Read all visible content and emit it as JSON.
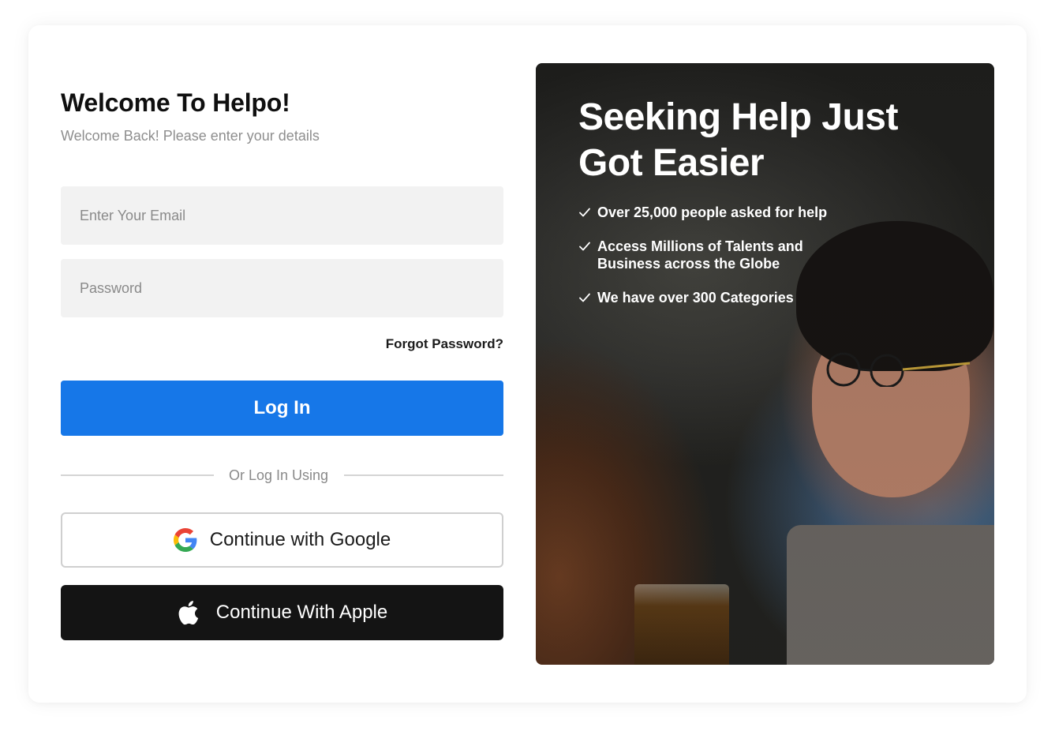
{
  "login": {
    "title": "Welcome To Helpo!",
    "subtitle": "Welcome Back! Please enter your details",
    "email_placeholder": "Enter Your Email",
    "password_placeholder": "Password",
    "forgot_label": "Forgot Password?",
    "login_label": "Log In",
    "divider_label": "Or Log In Using",
    "google_label": "Continue with Google",
    "apple_label": "Continue With Apple"
  },
  "hero": {
    "headline": "Seeking Help Just Got Easier",
    "bullets": [
      "Over 25,000 people asked for help",
      "Access Millions of Talents and Business across the Globe",
      "We have over 300 Categories"
    ],
    "icon": "check-icon"
  },
  "colors": {
    "primary": "#1677e8",
    "apple_bg": "#141414",
    "field_bg": "#f2f2f2"
  }
}
